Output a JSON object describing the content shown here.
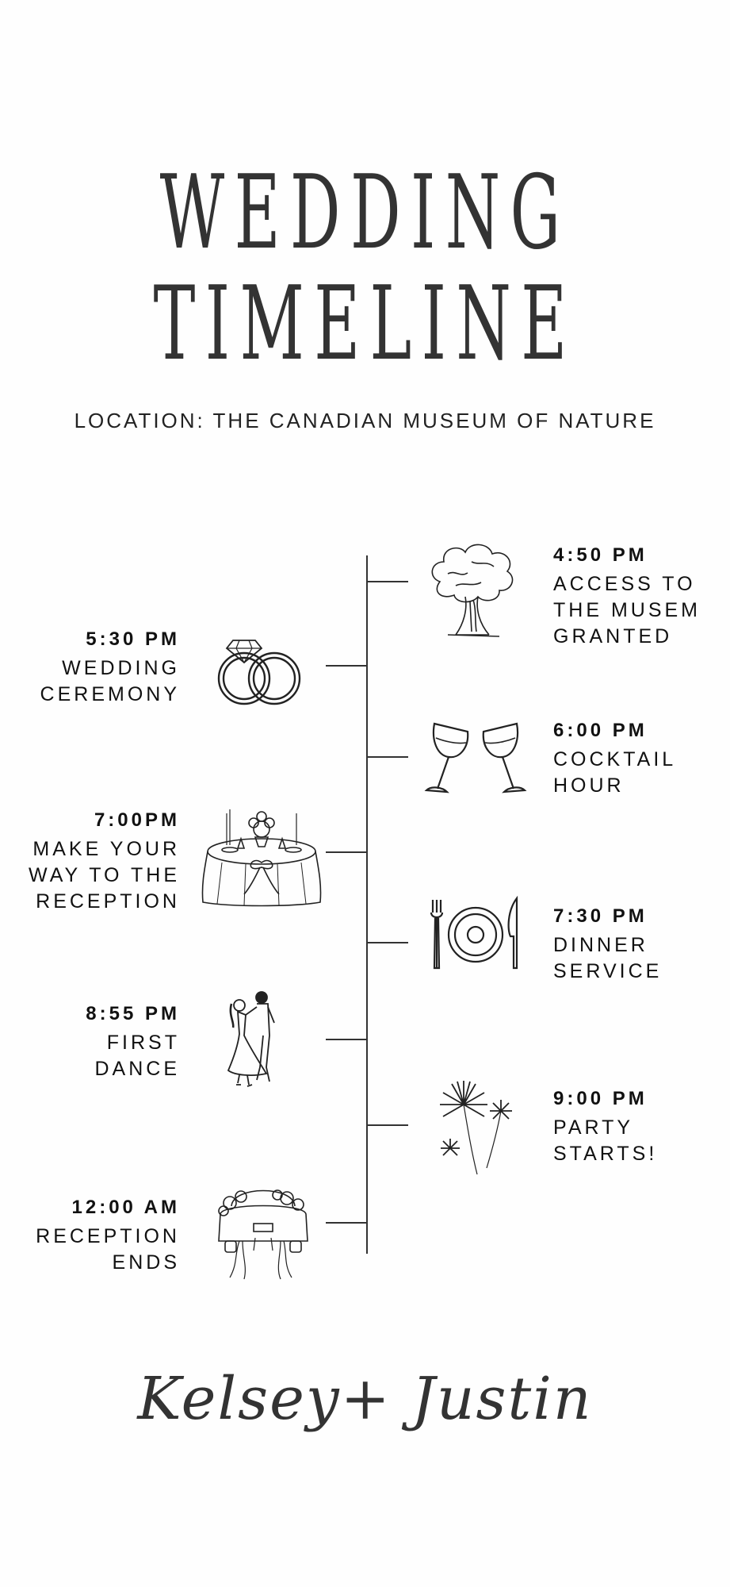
{
  "title": {
    "line1": "WEDDING",
    "line2": "TIMELINE"
  },
  "location": "LOCATION: THE CANADIAN MUSEUM OF NATURE",
  "events": [
    {
      "time": "4:50 PM",
      "desc": [
        "ACCESS TO",
        "THE MUSEM",
        "GRANTED"
      ],
      "icon": "tree-icon"
    },
    {
      "time": "5:30 PM",
      "desc": [
        "WEDDING",
        "CEREMONY"
      ],
      "icon": "rings-icon"
    },
    {
      "time": "6:00 PM",
      "desc": [
        "COCKTAIL",
        "HOUR"
      ],
      "icon": "wine-glasses-icon"
    },
    {
      "time": "7:00PM",
      "desc": [
        "MAKE YOUR",
        "WAY TO THE",
        "RECEPTION"
      ],
      "icon": "reception-table-icon"
    },
    {
      "time": "7:30 PM",
      "desc": [
        "DINNER",
        "SERVICE"
      ],
      "icon": "plate-cutlery-icon"
    },
    {
      "time": "8:55 PM",
      "desc": [
        "FIRST",
        "DANCE"
      ],
      "icon": "dancing-couple-icon"
    },
    {
      "time": "9:00 PM",
      "desc": [
        "PARTY",
        "STARTS!"
      ],
      "icon": "fireworks-icon"
    },
    {
      "time": "12:00 AM",
      "desc": [
        "RECEPTION",
        "ENDS"
      ],
      "icon": "getaway-car-icon"
    }
  ],
  "signature": "Kelsey+ Justin"
}
